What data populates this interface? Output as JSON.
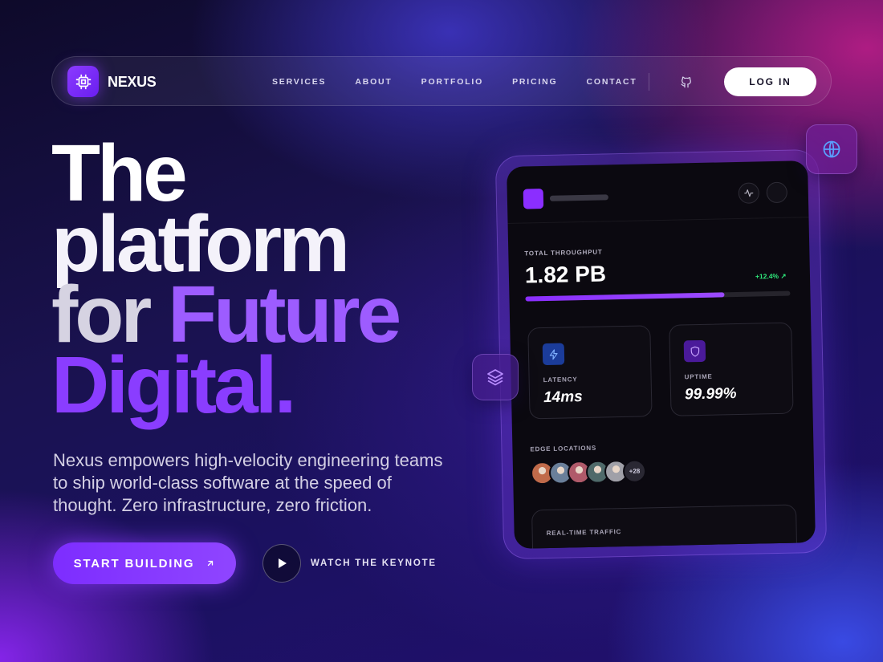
{
  "nav": {
    "brand": "NEXUS",
    "links": [
      "SERVICES",
      "ABOUT",
      "PORTFOLIO",
      "PRICING",
      "CONTACT"
    ],
    "login_label": "LOG IN",
    "icons": [
      "cpu-icon",
      "github-icon"
    ]
  },
  "hero": {
    "line1": "The",
    "line2": "platform",
    "line3_a": "for ",
    "line3_b": "Future",
    "line4": "Digital.",
    "subtitle": "Nexus empowers high-velocity engineering teams to ship world-class software at the speed of thought. Zero infrastructure, zero friction.",
    "cta_label": "START BUILDING",
    "secondary_label": "WATCH THE KEYNOTE"
  },
  "dashboard": {
    "throughput_label": "TOTAL THROUGHPUT",
    "throughput_value": "1.82 PB",
    "throughput_delta": "+12.4% ↗",
    "throughput_progress": 0.75,
    "latency_label": "LATENCY",
    "latency_value": "14ms",
    "uptime_label": "UPTIME",
    "uptime_value": "99.99%",
    "edge_label": "EDGE LOCATIONS",
    "avatar_colors": [
      "#c06a4a",
      "#6a7f9a",
      "#b05a6a",
      "#4f6a6a",
      "#a0a0a8"
    ],
    "avatar_more": "+28",
    "traffic_label": "REAL-TIME TRAFFIC"
  },
  "colors": {
    "accent": "#8b2eff",
    "positive": "#2ee67a",
    "latency_icon_bg": "#1b3c9a",
    "uptime_icon_bg": "#4a1a9a"
  }
}
